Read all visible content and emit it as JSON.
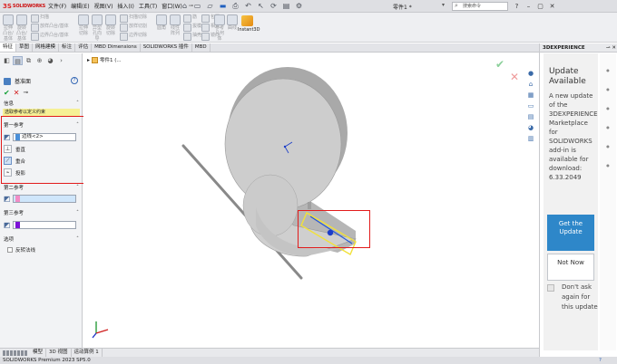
{
  "app": {
    "logo": "SOLIDWORKS",
    "menu": [
      "文件(F)",
      "编辑(E)",
      "视图(V)",
      "插入(I)",
      "工具(T)",
      "窗口(W)"
    ],
    "document_title": "零件1 *",
    "search_placeholder": "搜索命令"
  },
  "ribbon": {
    "groups": [
      {
        "label": "拉伸凸台/基体"
      },
      {
        "label": "旋转凸台/基体"
      },
      {
        "label": "扫描"
      },
      {
        "label": "放样凸台/基体"
      },
      {
        "label": "边界凸台/基体"
      },
      {
        "label": "拉伸切除"
      },
      {
        "label": "异型孔向导"
      },
      {
        "label": "旋转切除"
      },
      {
        "label": "扫描切除"
      },
      {
        "label": "放样切割"
      },
      {
        "label": "边界切除"
      },
      {
        "label": "圆角"
      },
      {
        "label": "线性阵列"
      },
      {
        "label": "筋"
      },
      {
        "label": "拔模"
      },
      {
        "label": "抽壳"
      },
      {
        "label": "包覆"
      },
      {
        "label": "相交"
      },
      {
        "label": "镜向"
      },
      {
        "label": "参考几何体"
      },
      {
        "label": "曲线"
      }
    ],
    "instant3d": "Instant3D"
  },
  "cm_tabs": [
    "特征",
    "草图",
    "网格建模",
    "标注",
    "评估",
    "MBD Dimensions",
    "SOLIDWORKS 插件",
    "MBD"
  ],
  "property_manager": {
    "title": "基准面",
    "info_header": "信息",
    "message": "选取参考以定义约束",
    "first_ref": {
      "header": "第一参考",
      "value": "边线<2>",
      "options": [
        "垂直",
        "重合",
        "投影"
      ]
    },
    "second_ref": {
      "header": "第二参考",
      "value": ""
    },
    "third_ref": {
      "header": "第三参考",
      "value": ""
    },
    "options_header": "选项",
    "flip_normal": "反转法线"
  },
  "viewport": {
    "tree_flyout": "零件1 (..."
  },
  "xpane": {
    "header": "3DEXPERIENCE",
    "title": "Update Available",
    "body": "A new update of the 3DEXPERIENCE Marketplace for SOLIDWORKS add-in is available for download: 6.33.2049",
    "get_button": "Get the Update",
    "not_now_button": "Not Now",
    "dont_ask": "Don't ask again for this update"
  },
  "bottom_tabs": [
    "模型",
    "3D 视图",
    "运动算例 1"
  ],
  "status": "SOLIDWORKS Premium 2023 SP5.0",
  "colors": {
    "selection_red": "#e21b1b",
    "accent_blue": "#2e87c9",
    "second_ref_swatch": "#f28cc6",
    "third_ref_swatch": "#7b10d6",
    "first_ref_swatch": "#4a8fd8"
  }
}
